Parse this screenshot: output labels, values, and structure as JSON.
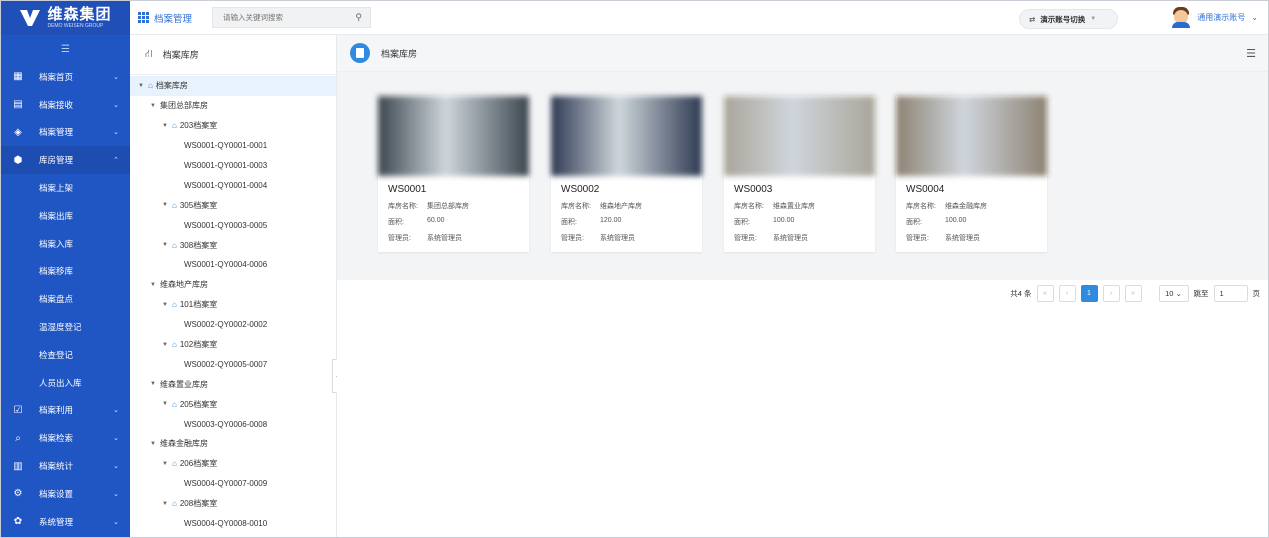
{
  "brand": {
    "name": "维森集团",
    "sub": "DEMO WEISEN GROUP"
  },
  "sidebar": {
    "items": [
      {
        "label": "档案首页",
        "icon": "dashboard-icon",
        "chev": "﹀"
      },
      {
        "label": "档案接收",
        "icon": "book-icon",
        "chev": "﹀"
      },
      {
        "label": "档案管理",
        "icon": "layers-icon",
        "chev": "﹀"
      },
      {
        "label": "库房管理",
        "icon": "cube-icon",
        "chev": "︿",
        "active": true
      },
      {
        "label": "档案上架",
        "sub": true
      },
      {
        "label": "档案出库",
        "sub": true
      },
      {
        "label": "档案入库",
        "sub": true
      },
      {
        "label": "档案移库",
        "sub": true
      },
      {
        "label": "档案盘点",
        "sub": true
      },
      {
        "label": "温湿度登记",
        "sub": true
      },
      {
        "label": "检查登记",
        "sub": true
      },
      {
        "label": "人员出入库",
        "sub": true
      },
      {
        "label": "档案利用",
        "icon": "checklist-icon",
        "chev": "﹀"
      },
      {
        "label": "档案检索",
        "icon": "search-doc-icon",
        "chev": "﹀"
      },
      {
        "label": "档案统计",
        "icon": "bar-chart-icon",
        "chev": "﹀"
      },
      {
        "label": "档案设置",
        "icon": "settings-doc-icon",
        "chev": "﹀"
      },
      {
        "label": "系统管理",
        "icon": "gear-icon",
        "chev": "﹀"
      }
    ]
  },
  "topbar": {
    "module": "档案管理",
    "search_placeholder": "请输入关键词搜索",
    "switch_label": "演示账号切换",
    "user_name": "通用演示账号"
  },
  "tree": {
    "title": "档案库房",
    "nodes": [
      {
        "label": "档案库房",
        "level": 0,
        "tri": true,
        "icon": true,
        "selected": true
      },
      {
        "label": "集团总部库房",
        "level": 1,
        "tri": true
      },
      {
        "label": "203档案室",
        "level": 2,
        "tri": true,
        "icon": true
      },
      {
        "label": "WS0001-QY0001-0001",
        "level": 3
      },
      {
        "label": "WS0001-QY0001-0003",
        "level": 3
      },
      {
        "label": "WS0001-QY0001-0004",
        "level": 3
      },
      {
        "label": "305档案室",
        "level": 2,
        "tri": true,
        "icon": true
      },
      {
        "label": "WS0001-QY0003-0005",
        "level": 3
      },
      {
        "label": "308档案室",
        "level": 2,
        "tri": true,
        "icon": true
      },
      {
        "label": "WS0001-QY0004-0006",
        "level": 3
      },
      {
        "label": "维森地产库房",
        "level": 1,
        "tri": true
      },
      {
        "label": "101档案室",
        "level": 2,
        "tri": true,
        "icon": true
      },
      {
        "label": "WS0002-QY0002-0002",
        "level": 3
      },
      {
        "label": "102档案室",
        "level": 2,
        "tri": true,
        "icon": true
      },
      {
        "label": "WS0002-QY0005-0007",
        "level": 3
      },
      {
        "label": "维森置业库房",
        "level": 1,
        "tri": true
      },
      {
        "label": "205档案室",
        "level": 2,
        "tri": true,
        "icon": true
      },
      {
        "label": "WS0003-QY0006-0008",
        "level": 3
      },
      {
        "label": "维森金融库房",
        "level": 1,
        "tri": true
      },
      {
        "label": "206档案室",
        "level": 2,
        "tri": true,
        "icon": true
      },
      {
        "label": "WS0004-QY0007-0009",
        "level": 3
      },
      {
        "label": "208档案室",
        "level": 2,
        "tri": true,
        "icon": true
      },
      {
        "label": "WS0004-QY0008-0010",
        "level": 3
      }
    ]
  },
  "content": {
    "title": "档案库房",
    "field_labels": {
      "name": "库房名称:",
      "area": "面积:",
      "manager": "管理员:"
    },
    "cards": [
      {
        "code": "WS0001",
        "name": "集团总部库房",
        "area": "60.00",
        "manager": "系统管理员",
        "tone": "#3c4750"
      },
      {
        "code": "WS0002",
        "name": "维森地产库房",
        "area": "120.00",
        "manager": "系统管理员",
        "tone": "#2e3a52"
      },
      {
        "code": "WS0003",
        "name": "维森置业库房",
        "area": "100.00",
        "manager": "系统管理员",
        "tone": "#a9a59a"
      },
      {
        "code": "WS0004",
        "name": "维森金融库房",
        "area": "100.00",
        "manager": "系统管理员",
        "tone": "#8d8273"
      }
    ]
  },
  "pagination": {
    "total": "共4 条",
    "current": "1",
    "page_size": "10",
    "jump_label": "跳至",
    "jump_value": "1",
    "page_unit": "页"
  },
  "colors": {
    "sidebar": "#2056c4",
    "accent": "#2f8ae0"
  }
}
